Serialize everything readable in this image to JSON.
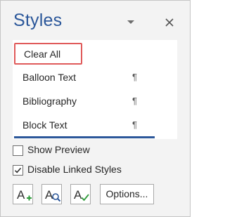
{
  "pane": {
    "title": "Styles",
    "dropdown_icon": "triangle-down-icon",
    "close_icon": "close-x-icon"
  },
  "styles_list": {
    "items": [
      {
        "label": "Clear All",
        "highlighted": true,
        "has_pilcrow": false
      },
      {
        "label": "Balloon Text",
        "pilcrow": "¶"
      },
      {
        "label": "Bibliography",
        "pilcrow": "¶"
      },
      {
        "label": "Block Text",
        "pilcrow": "¶"
      }
    ]
  },
  "options": {
    "show_preview": {
      "label": "Show Preview",
      "checked": false
    },
    "disable_linked_styles": {
      "label": "Disable Linked Styles",
      "checked": true
    }
  },
  "toolbar": {
    "new_style_icon": "new-style-icon",
    "style_inspector_icon": "style-inspector-icon",
    "manage_styles_icon": "manage-styles-icon",
    "options_label": "Options..."
  },
  "colors": {
    "title": "#2b579a",
    "highlight_border": "#e05a5a",
    "new_style_plus": "#2e9a3a",
    "inspector_lens": "#2b579a",
    "manage_check": "#2e9a3a"
  }
}
